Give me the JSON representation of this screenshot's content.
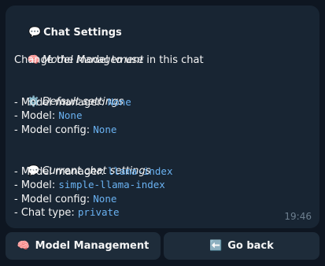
{
  "message": {
    "title_icon": "💬",
    "title": "Chat Settings",
    "model_management": {
      "icon": "🧠",
      "heading": "Model Management",
      "desc": "Change the model to use in this chat"
    },
    "default_settings": {
      "icon": "⚙️",
      "heading": "Default settings",
      "rows": [
        {
          "label": "- Model manager: ",
          "value": "None"
        },
        {
          "label": "- Model: ",
          "value": "None"
        },
        {
          "label": "- Model config: ",
          "value": "None"
        }
      ]
    },
    "current_settings": {
      "icon": "💬",
      "heading": "Current chat settings",
      "rows": [
        {
          "label": "- Model manager: ",
          "value": "llama-index"
        },
        {
          "label": "- Model: ",
          "value": "simple-llama-index"
        },
        {
          "label": "- Model config: ",
          "value": "None"
        },
        {
          "label": "- Chat type: ",
          "value": "private"
        }
      ]
    },
    "time": "19:46"
  },
  "buttons": {
    "model_management": {
      "icon": "🧠",
      "label": "Model Management"
    },
    "go_back": {
      "icon": "⬅️",
      "label": "Go back"
    }
  },
  "colors": {
    "background": "#0e1621",
    "bubble": "#182533",
    "code": "#6ab2f2",
    "button": "#1e2c3a"
  }
}
